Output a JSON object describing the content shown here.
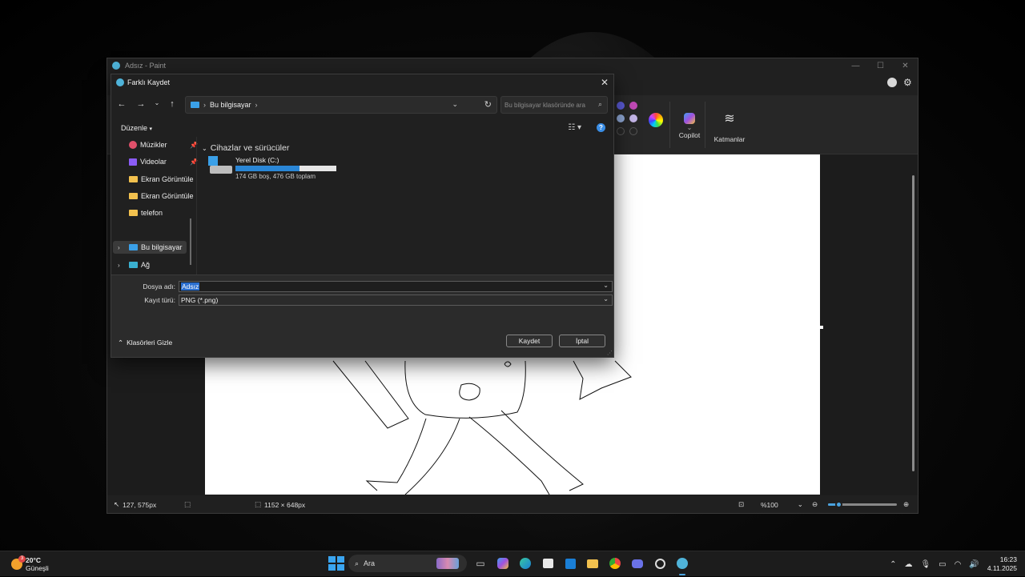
{
  "paint": {
    "title": "Adsız - Paint",
    "window_controls": [
      "—",
      "☐",
      "✕"
    ],
    "ribbon": {
      "copilot_label": "Copilot",
      "layers_label": "Katmanlar",
      "swatch_colors": [
        "#5b5bd6",
        "#c049b6",
        "#8fa8d6",
        "#c3b4e6",
        "#2a2a2a",
        "#2a2a2a"
      ]
    },
    "status": {
      "cursor_pos": "127, 575px",
      "canvas_size": "1152 × 648px",
      "zoom": "%100",
      "zoom_level": 0.15
    }
  },
  "dialog": {
    "title": "Farklı Kaydet",
    "address": "Bu bilgisayar",
    "search_placeholder": "Bu bilgisayar klasöründe ara",
    "organize_label": "Düzenle",
    "nav_items": [
      {
        "label": "Müzikler",
        "pinned": true
      },
      {
        "label": "Videolar",
        "pinned": true
      },
      {
        "label": "Ekran Görüntüle"
      },
      {
        "label": "Ekran Görüntüle"
      },
      {
        "label": "telefon"
      },
      {
        "label": "Bu bilgisayar",
        "selected": true
      },
      {
        "label": "Ağ"
      }
    ],
    "group_header": "Cihazlar ve sürücüler",
    "drive": {
      "name": "Yerel Disk (C:)",
      "info": "174 GB boş, 476 GB toplam",
      "used_fraction": 0.634
    },
    "filename_label": "Dosya adı:",
    "filename_value": "Adsız",
    "filetype_label": "Kayıt türü:",
    "filetype_value": "PNG (*.png)",
    "hide_folders_label": "Klasörleri Gizle",
    "save_button": "Kaydet",
    "cancel_button": "İptal"
  },
  "taskbar": {
    "temperature": "20°C",
    "weather": "Güneşli",
    "weather_badge": "3",
    "search_label": "Ara",
    "time": "16:23",
    "date": "4.11.2025"
  }
}
